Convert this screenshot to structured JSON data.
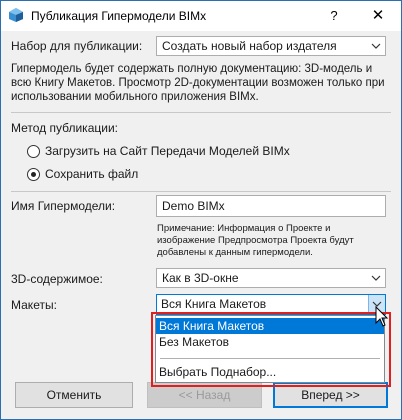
{
  "window": {
    "title": "Публикация Гипермодели BIMx",
    "help_glyph": "?",
    "close_glyph": "✕"
  },
  "publish_set": {
    "label": "Набор для публикации:",
    "value": "Создать новый набор издателя",
    "description": "Гипермодель будет содержать полную документацию: 3D-модель и всю Книгу Макетов. Просмотр 2D-документации возможен только при использовании мобильного приложения BIMx."
  },
  "method": {
    "label": "Метод публикации:",
    "options": [
      {
        "label": "Загрузить на Сайт Передачи Моделей BIMx",
        "checked": false
      },
      {
        "label": "Сохранить файл",
        "checked": true
      }
    ]
  },
  "hypermodel_name": {
    "label": "Имя Гипермодели:",
    "value": "Demo BIMx",
    "note": "Примечание: Информация о Проекте и изображение Предпросмотра Проекта будут добавлены к данным гипермодели."
  },
  "content_3d": {
    "label": "3D-содержимое:",
    "value": "Как в 3D-окне"
  },
  "layouts": {
    "label": "Макеты:",
    "value": "Вся Книга Макетов",
    "options": [
      {
        "label": "Вся Книга Макетов",
        "selected": true
      },
      {
        "label": "Без Макетов",
        "selected": false
      },
      {
        "label": "Выбрать Поднабор...",
        "selected": false
      }
    ]
  },
  "buttons": {
    "cancel": "Отменить",
    "back": "<< Назад",
    "next": "Вперед >>"
  },
  "colors": {
    "accent": "#0078d7",
    "highlight_outline": "#e0201e"
  }
}
